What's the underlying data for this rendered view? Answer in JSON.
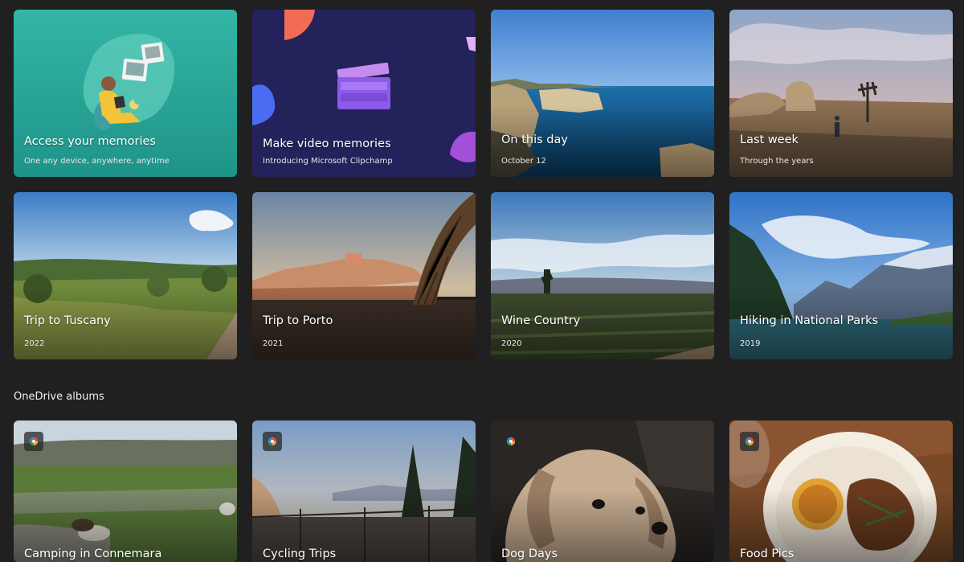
{
  "memories": [
    {
      "title": "Access your memories",
      "subtitle": "One any device, anywhere, anytime"
    },
    {
      "title": "Make video memories",
      "subtitle": "Introducing Microsoft Clipchamp"
    },
    {
      "title": "On this day",
      "subtitle": "October 12"
    },
    {
      "title": "Last week",
      "subtitle": "Through the years"
    }
  ],
  "trips": [
    {
      "title": "Trip to Tuscany",
      "subtitle": "2022"
    },
    {
      "title": "Trip to Porto",
      "subtitle": "2021"
    },
    {
      "title": "Wine Country",
      "subtitle": "2020"
    },
    {
      "title": "Hiking in National Parks",
      "subtitle": "2019"
    }
  ],
  "onedrive": {
    "section_title": "OneDrive albums",
    "albums": [
      {
        "title": "Camping in Connemara"
      },
      {
        "title": "Cycling Trips"
      },
      {
        "title": "Dog Days"
      },
      {
        "title": "Food Pics"
      }
    ]
  },
  "colors": {
    "background": "#202020",
    "promo_teal": "#2aa898",
    "promo_navy": "#23225a"
  }
}
